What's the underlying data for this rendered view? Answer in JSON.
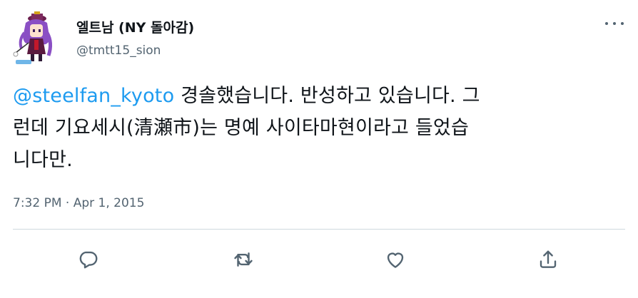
{
  "author": {
    "display_name": "엘트남 (NY 돌아감)",
    "handle": "@tmtt15_sion"
  },
  "tweet": {
    "mention": "@steelfan_kyoto",
    "line1_rest": " 경솔했습니다. 반성하고 있습니다. 그",
    "line2": "런데 기요세시(清瀬市)는 명예 사이타마현이라고 들었습",
    "line3": "니다만.",
    "timestamp": "7:32 PM · Apr 1, 2015"
  },
  "icons": {
    "more": "more-horizontal-icon",
    "reply": "reply-icon",
    "retweet": "retweet-icon",
    "like": "like-icon",
    "share": "share-icon"
  },
  "colors": {
    "mention": "#1d9bf0",
    "secondary_text": "#536471",
    "divider": "#cfd9de"
  }
}
